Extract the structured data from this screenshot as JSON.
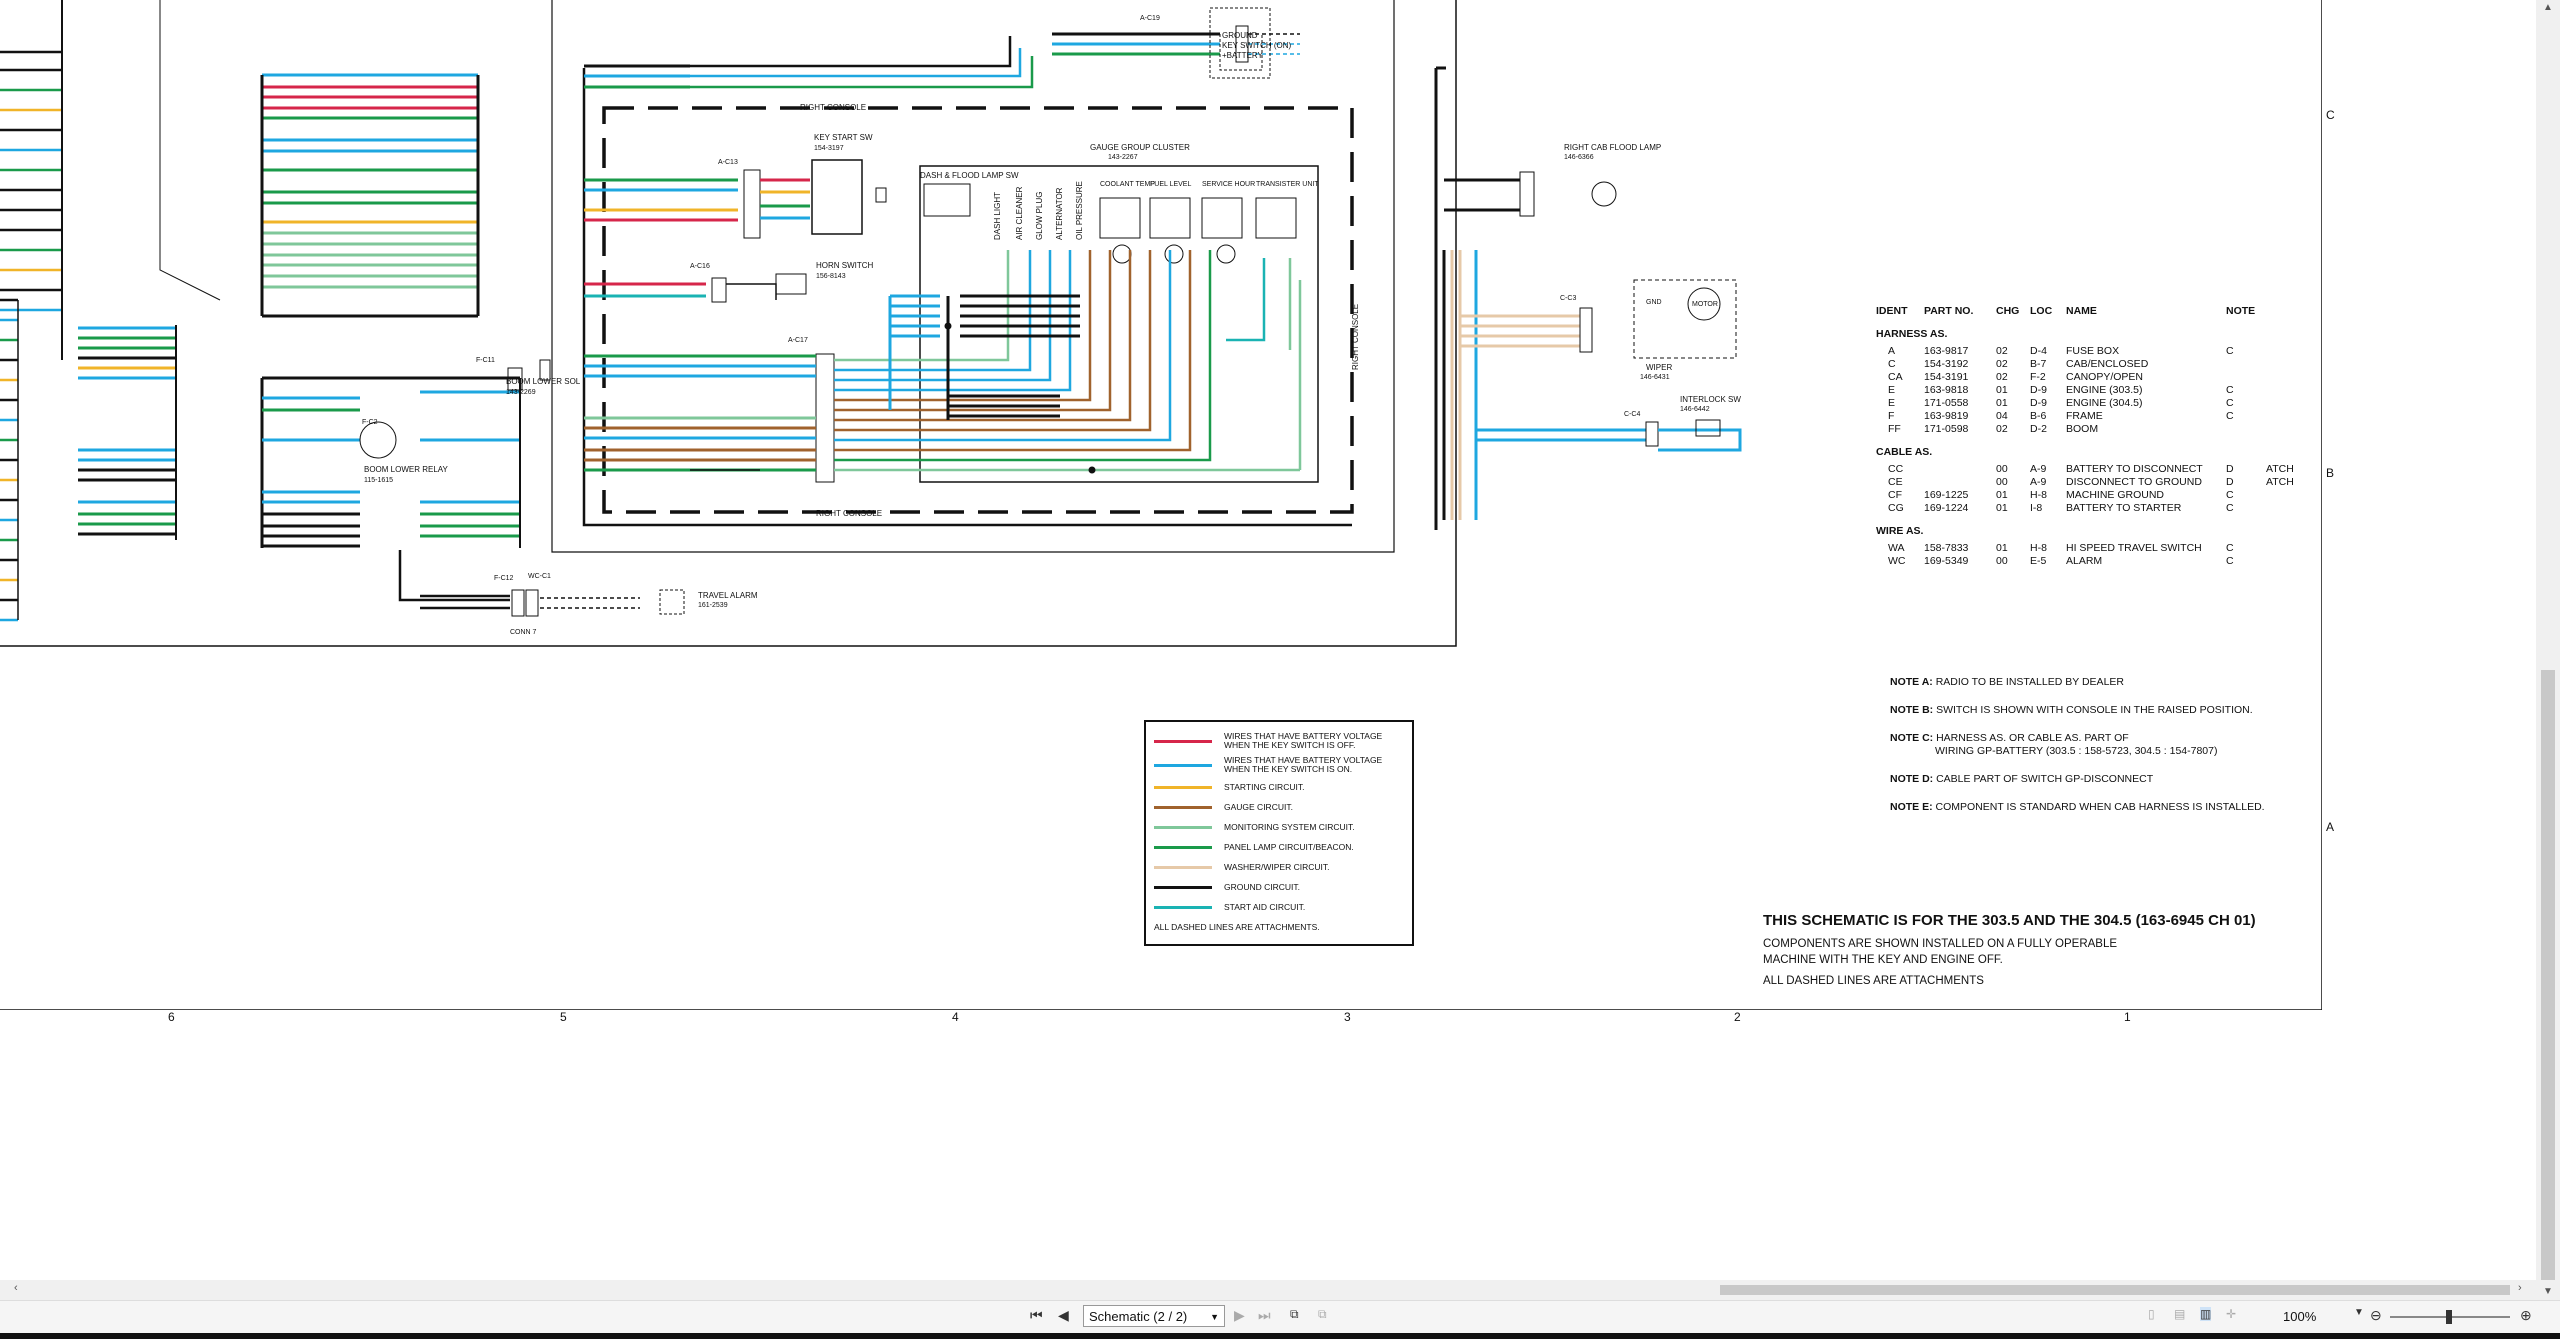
{
  "schematic": {
    "title": "THIS SCHEMATIC IS FOR THE 303.5 AND THE 304.5 (163-6945 CH 01)",
    "components_note": [
      "COMPONENTS ARE SHOWN INSTALLED ON A FULLY OPERABLE",
      "MACHINE WITH THE KEY AND ENGINE OFF."
    ],
    "dashed_note": "ALL DASHED LINES ARE ATTACHMENTS",
    "labels": {
      "right_console_top": "RIGHT CONSOLE",
      "right_console_bottom": "RIGHT CONSOLE",
      "right_console_side": "RIGHT CONSOLE",
      "key_start_sw": "KEY START SW",
      "key_start_pn": "154-3197",
      "dash_flood_sw": "DASH & FLOOD LAMP SW",
      "gauge_cluster": "GAUGE GROUP CLUSTER",
      "gauge_cluster_pn": "143-2267",
      "horn_switch": "HORN SWITCH",
      "horn_pn": "156-8143",
      "boom_lower_sol": "BOOM LOWER SOL",
      "boom_lower_sol_pn": "143-2269",
      "boom_lower_relay": "BOOM LOWER RELAY",
      "boom_lower_relay_pn": "115-1615",
      "travel_alarm": "TRAVEL ALARM",
      "travel_alarm_pn": "161-2539",
      "conn7": "CONN 7",
      "right_cab_flood": "RIGHT CAB FLOOD LAMP",
      "right_cab_flood_pn": "146-6366",
      "wiper": "WIPER",
      "wiper_pn": "146-6431",
      "interlock_sw": "INTERLOCK SW",
      "interlock_pn": "146-6442",
      "ground": "GROUND",
      "key_switch_on": "KEY SWITCH (ON)",
      "battery": "+BATTERY",
      "motor": "MOTOR",
      "gnd": "GND",
      "a_c19": "A-C19",
      "a_c13": "A-C13",
      "a_c16": "A-C16",
      "a_c17": "A-C17",
      "f_c11": "F-C11",
      "f_c2": "F-C2",
      "f_c12": "F-C12",
      "wc_c1": "WC-C1",
      "c_c3": "C-C3",
      "c_c4": "C-C4",
      "conn_pn": "1552269"
    },
    "gauge_labels": [
      "DASH LIGHT",
      "AIR CLEANER",
      "GLOW PLUG",
      "ALTERNATOR",
      "OIL PRESSURE"
    ],
    "gauge_boxes": [
      "COOLANT TEMP",
      "FUEL LEVEL",
      "SERVICE HOUR",
      "TRANSISTER UNIT"
    ],
    "column_numbers": [
      "6",
      "5",
      "4",
      "3",
      "2",
      "1"
    ],
    "row_letters": [
      "C",
      "B",
      "A"
    ]
  },
  "info": {
    "headers": [
      "IDENT",
      "PART NO.",
      "CHG",
      "LOC",
      "NAME",
      "NOTE"
    ],
    "harness_title": "HARNESS AS.",
    "harness": [
      {
        "ident": "A",
        "part": "163-9817",
        "chg": "02",
        "loc": "D-4",
        "name": "FUSE BOX",
        "note": "C"
      },
      {
        "ident": "C",
        "part": "154-3192",
        "chg": "02",
        "loc": "B-7",
        "name": "CAB/ENCLOSED",
        "note": ""
      },
      {
        "ident": "CA",
        "part": "154-3191",
        "chg": "02",
        "loc": "F-2",
        "name": "CANOPY/OPEN",
        "note": ""
      },
      {
        "ident": "E",
        "part": "163-9818",
        "chg": "01",
        "loc": "D-9",
        "name": "ENGINE (303.5)",
        "note": "C"
      },
      {
        "ident": "E",
        "part": "171-0558",
        "chg": "01",
        "loc": "D-9",
        "name": "ENGINE (304.5)",
        "note": "C"
      },
      {
        "ident": "F",
        "part": "163-9819",
        "chg": "04",
        "loc": "B-6",
        "name": "FRAME",
        "note": "C"
      },
      {
        "ident": "FF",
        "part": "171-0598",
        "chg": "02",
        "loc": "D-2",
        "name": "BOOM",
        "note": ""
      }
    ],
    "cable_title": "CABLE AS.",
    "cable": [
      {
        "ident": "CC",
        "part": "",
        "chg": "00",
        "loc": "A-9",
        "name": "BATTERY TO DISCONNECT",
        "note": "D",
        "extra": "ATCH"
      },
      {
        "ident": "CE",
        "part": "",
        "chg": "00",
        "loc": "A-9",
        "name": "DISCONNECT TO GROUND",
        "note": "D",
        "extra": "ATCH"
      },
      {
        "ident": "CF",
        "part": "169-1225",
        "chg": "01",
        "loc": "H-8",
        "name": "MACHINE GROUND",
        "note": "C",
        "extra": ""
      },
      {
        "ident": "CG",
        "part": "169-1224",
        "chg": "01",
        "loc": "I-8",
        "name": "BATTERY TO STARTER",
        "note": "C",
        "extra": ""
      }
    ],
    "wire_title": "WIRE AS.",
    "wire": [
      {
        "ident": "WA",
        "part": "158-7833",
        "chg": "01",
        "loc": "H-8",
        "name": "HI SPEED TRAVEL SWITCH",
        "note": "C"
      },
      {
        "ident": "WC",
        "part": "169-5349",
        "chg": "00",
        "loc": "E-5",
        "name": "ALARM",
        "note": "C"
      }
    ],
    "notes": [
      {
        "label": "NOTE A:",
        "text": "RADIO TO BE INSTALLED BY DEALER"
      },
      {
        "label": "NOTE B:",
        "text": "SWITCH IS SHOWN WITH CONSOLE IN THE RAISED POSITION."
      },
      {
        "label": "NOTE C:",
        "text": "HARNESS AS. OR CABLE AS. PART OF",
        "text2": "WIRING GP-BATTERY (303.5 : 158-5723, 304.5 : 154-7807)"
      },
      {
        "label": "NOTE D:",
        "text": "CABLE PART OF SWITCH GP-DISCONNECT"
      },
      {
        "label": "NOTE E:",
        "text": "COMPONENT IS STANDARD WHEN CAB HARNESS IS INSTALLED."
      }
    ]
  },
  "legend": {
    "items": [
      {
        "color": "#d6264a",
        "text1": "WIRES THAT HAVE BATTERY VOLTAGE",
        "text2": "WHEN THE KEY SWITCH IS OFF."
      },
      {
        "color": "#1ea7e0",
        "text1": "WIRES THAT HAVE BATTERY VOLTAGE",
        "text2": "WHEN THE KEY SWITCH IS ON."
      },
      {
        "color": "#f0b429",
        "text1": "STARTING CIRCUIT.",
        "text2": ""
      },
      {
        "color": "#a0622d",
        "text1": "GAUGE CIRCUIT.",
        "text2": ""
      },
      {
        "color": "#7fc79a",
        "text1": "MONITORING SYSTEM CIRCUIT.",
        "text2": ""
      },
      {
        "color": "#1a9a4a",
        "text1": "PANEL LAMP CIRCUIT/BEACON.",
        "text2": ""
      },
      {
        "color": "#e6c9a8",
        "text1": "WASHER/WIPER CIRCUIT.",
        "text2": ""
      },
      {
        "color": "#111111",
        "text1": "GROUND CIRCUIT.",
        "text2": ""
      },
      {
        "color": "#1ab3b3",
        "text1": "START AID CIRCUIT.",
        "text2": ""
      }
    ],
    "footer": "ALL DASHED LINES ARE ATTACHMENTS."
  },
  "toolbar": {
    "page_select": "Schematic (2 / 2)",
    "zoom": "100%"
  },
  "icons": [
    "first-page-icon",
    "prev-page-icon",
    "next-page-icon",
    "last-page-icon",
    "zoom-out-icon",
    "zoom-in-icon"
  ]
}
